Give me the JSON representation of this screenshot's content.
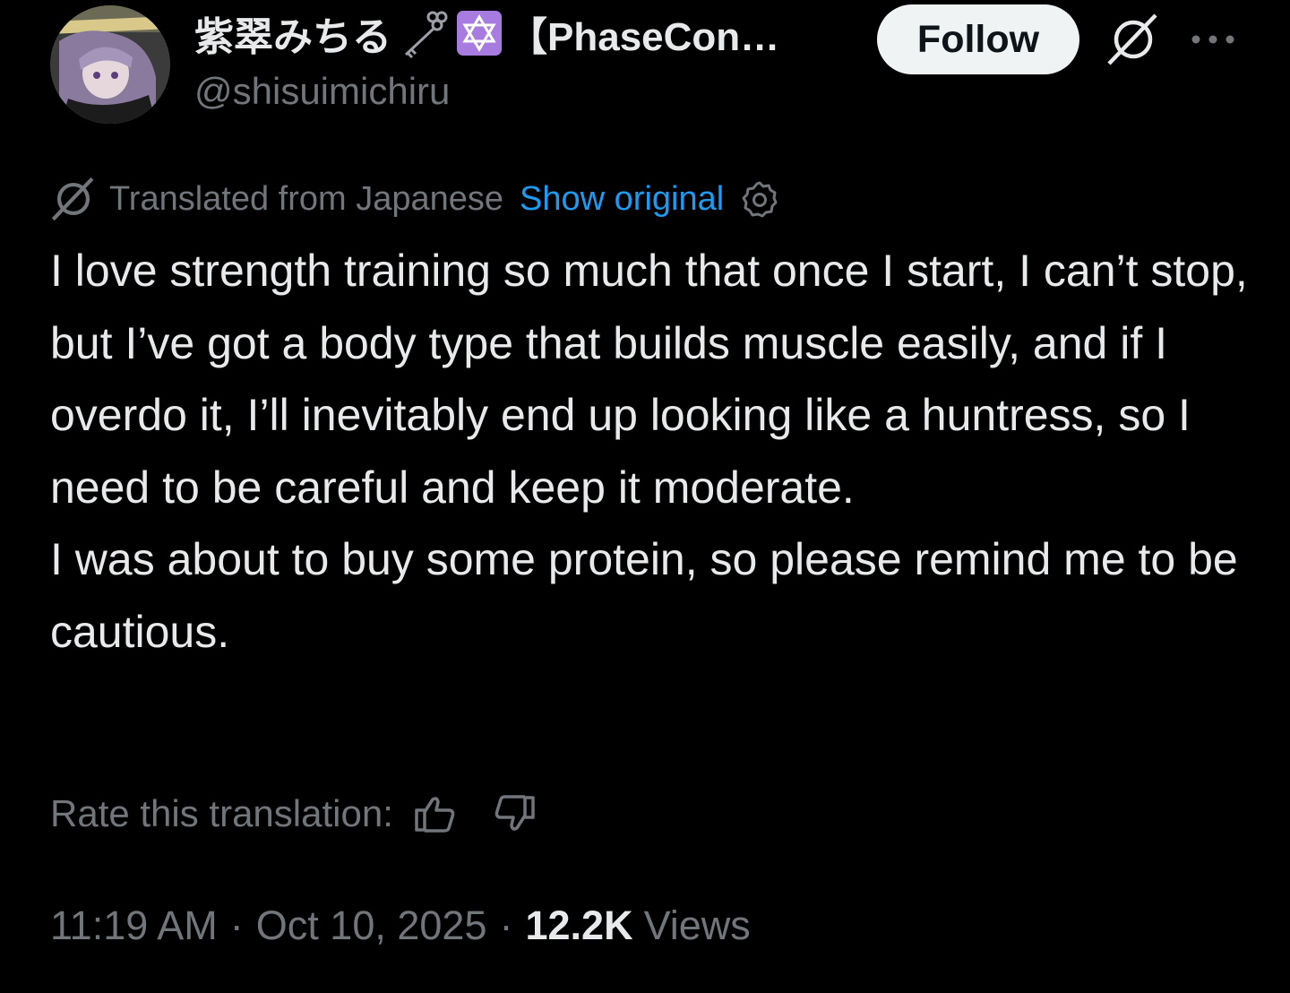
{
  "author": {
    "display_name": "紫翠みちる",
    "display_name_suffix": "【PhaseCon…",
    "handle": "@shisuimichiru",
    "badges": [
      "key-icon",
      "star-of-david-icon"
    ]
  },
  "header": {
    "follow_label": "Follow",
    "grok_icon": "grok-icon",
    "more_icon": "more-icon"
  },
  "translation": {
    "label": "Translated from Japanese",
    "show_original": "Show original",
    "settings_icon": "gear-icon",
    "rate_label": "Rate this translation:"
  },
  "tweet": {
    "paragraphs": [
      "I love strength training so much that once I start, I can’t stop, but I’ve got a body type that builds muscle easily, and if I overdo it, I’ll inevitably end up looking like a huntress, so I need to be careful and keep it moderate.",
      "I was about to buy some protein, so please remind me to be cautious."
    ]
  },
  "meta": {
    "time": "11:19 AM",
    "separator": "·",
    "date": "Oct 10, 2025",
    "views_count": "12.2K",
    "views_label": "Views"
  },
  "colors": {
    "background": "#000000",
    "text_primary": "#e7e9ea",
    "text_secondary": "#71767b",
    "link": "#1d9bf0",
    "follow_bg": "#eff3f4",
    "badge_purple": "#a77be0"
  }
}
